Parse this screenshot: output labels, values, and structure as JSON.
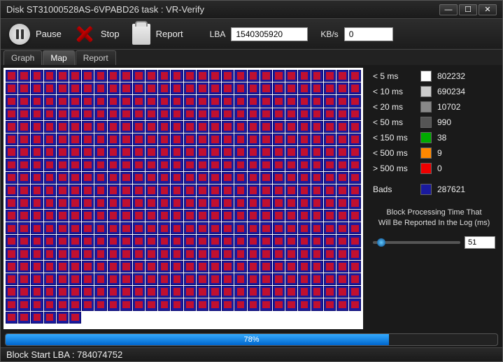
{
  "title": "Disk ST31000528AS-6VPABD26   task : VR-Verify",
  "toolbar": {
    "pause": "Pause",
    "stop": "Stop",
    "report": "Report",
    "lba_label": "LBA",
    "lba_value": "1540305920",
    "kbs_label": "KB/s",
    "kbs_value": "0"
  },
  "tabs": [
    "Graph",
    "Map",
    "Report"
  ],
  "active_tab": 1,
  "legend": [
    {
      "label": "< 5 ms",
      "swatch": "sw-white",
      "count": "802232"
    },
    {
      "label": "< 10 ms",
      "swatch": "sw-ltgrey",
      "count": "690234"
    },
    {
      "label": "< 20 ms",
      "swatch": "sw-grey",
      "count": "10702"
    },
    {
      "label": "< 50 ms",
      "swatch": "sw-dkgrey",
      "count": "990"
    },
    {
      "label": "< 150 ms",
      "swatch": "sw-green",
      "count": "38"
    },
    {
      "label": "< 500 ms",
      "swatch": "sw-orange",
      "count": "9"
    },
    {
      "label": "> 500 ms",
      "swatch": "sw-red",
      "count": "0"
    }
  ],
  "bads": {
    "label": "Bads",
    "swatch": "sw-blue",
    "count": "287621"
  },
  "block_time_text1": "Block Processing Time That",
  "block_time_text2": "Will Be Reported In the Log (ms)",
  "slider_value": "51",
  "slider_pos_pct": 5,
  "progress": {
    "pct": 78,
    "label": "78%"
  },
  "status": "Block Start LBA : 784074752",
  "grid": {
    "cols": 28,
    "full_rows": 19,
    "last_row_cells": 6
  }
}
